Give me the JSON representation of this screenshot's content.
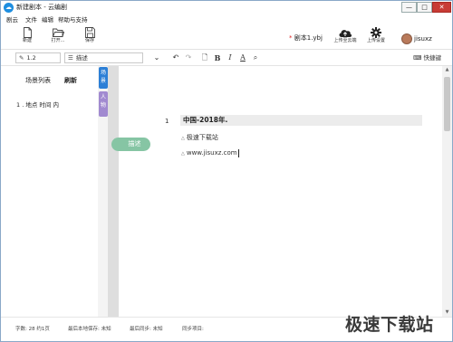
{
  "window": {
    "title": "新建剧本 - 云编剧",
    "app_icon": "cloud-app-icon",
    "controls": {
      "minimize": "—",
      "maximize": "□",
      "close": "✕"
    }
  },
  "menu": [
    "剧云",
    "文件",
    "编辑",
    "帮助与支持"
  ],
  "toolbar": {
    "new_label": "新建",
    "open_label": "打开...",
    "save_label": "保存",
    "doc_title_marker": "*",
    "doc_title": "剧本1.ybj",
    "cloud_upload_label": "上传至云端",
    "upload_settings_label": "上传设置",
    "username": "jisuxz"
  },
  "formatbar": {
    "scene_number": "1.2",
    "element_type": "描述",
    "bold": "B",
    "italic": "I",
    "underline": "A",
    "quick_keys_label": "快捷键"
  },
  "scene_panel": {
    "title": "场景列表",
    "refresh": "刷新",
    "items": [
      "1 . 地点 时间 内"
    ]
  },
  "vertical_tabs": {
    "scene": "场景",
    "character": "人物"
  },
  "element_bubble": "描述",
  "editor": {
    "line_number": "1",
    "scene_heading": "中国-2018年.",
    "descriptions": [
      "极速下载站",
      "www.jisuxz.com"
    ]
  },
  "statusbar": {
    "count": "字数: 28 约1页",
    "local_save": "最后本地保存: 未知",
    "last_sync": "最后同步: 未知",
    "sync_project": "同步项目:"
  },
  "watermark": "极速下载站",
  "colors": {
    "accent_blue": "#2c7fd6",
    "character_tab": "#a18ad0",
    "description_bubble": "#86c5a4",
    "close_button": "#c83b35"
  }
}
